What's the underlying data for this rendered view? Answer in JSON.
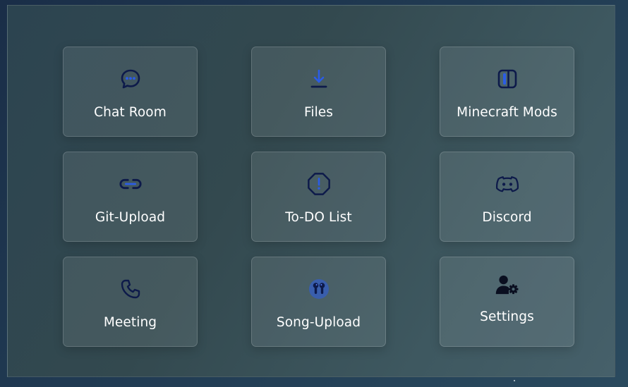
{
  "tiles": [
    {
      "label": "Chat Room",
      "icon": "chat-bubble-icon"
    },
    {
      "label": "Files",
      "icon": "download-icon"
    },
    {
      "label": "Minecraft Mods",
      "icon": "panels-icon"
    },
    {
      "label": "Git-Upload",
      "icon": "link-icon"
    },
    {
      "label": "To-DO List",
      "icon": "octagon-alert-icon"
    },
    {
      "label": "Discord",
      "icon": "discord-icon"
    },
    {
      "label": "Meeting",
      "icon": "phone-icon"
    },
    {
      "label": "Song-Upload",
      "icon": "earbuds-icon"
    },
    {
      "label": "Settings",
      "icon": "user-gear-icon"
    }
  ],
  "colors": {
    "icon_dark": "#0d1a4a",
    "icon_accent": "#2b5ce6",
    "label": "#ffffff"
  }
}
